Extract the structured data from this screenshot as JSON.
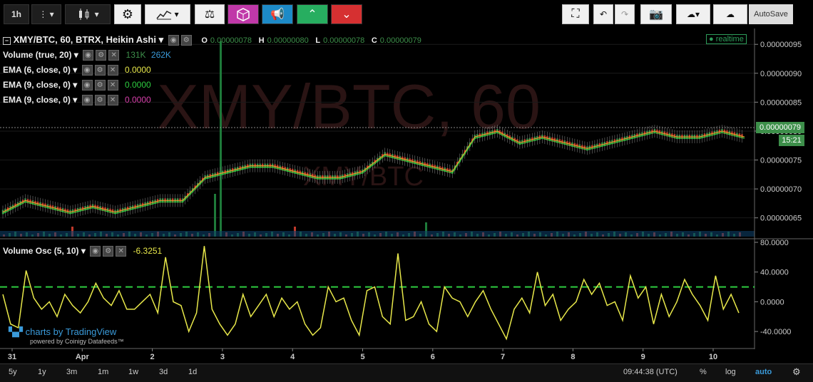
{
  "toolbar": {
    "interval": "1h",
    "autosave": "AutoSave",
    "colors": {
      "pink": "#c038a8",
      "blue": "#1d8ac7",
      "green": "#27ae60",
      "red": "#d63031"
    }
  },
  "legend": {
    "symbol": "XMY/BTC, 60, BTRX, Heikin Ashi",
    "o_label": "O",
    "o_val": "0.00000078",
    "h_label": "H",
    "h_val": "0.00000080",
    "l_label": "L",
    "l_val": "0.00000078",
    "c_label": "C",
    "c_val": "0.00000079",
    "volume": "Volume (true, 20)",
    "vol1": "131K",
    "vol2": "262K",
    "ema1": "EMA (6, close, 0)",
    "ema1_val": "0.0000",
    "ema2": "EMA (9, close, 0)",
    "ema2_val": "0.0000",
    "ema3": "EMA (9, close, 0)",
    "ema3_val": "0.0000",
    "osc": "Volume Osc (5, 10)",
    "osc_val": "-6.3251",
    "realtime": "realtime"
  },
  "watermark": {
    "big": "XMY/BTC, 60",
    "small": "XMY/BTC"
  },
  "price_axis": {
    "ticks": [
      "0.00000095",
      "0.00000090",
      "0.00000085",
      "0.00000080",
      "0.00000075",
      "0.00000070",
      "0.00000065"
    ],
    "last_price": "0.00000079",
    "countdown": "15:21"
  },
  "osc_axis": {
    "ticks": [
      "80.0000",
      "40.0000",
      "0.0000",
      "-40.0000"
    ]
  },
  "time_axis": [
    "31",
    "Apr",
    "2",
    "3",
    "4",
    "5",
    "6",
    "7",
    "8",
    "9",
    "10"
  ],
  "branding": {
    "line1": "charts by TradingView",
    "line2": "powered by Coinigy Datafeeds™"
  },
  "bottom_bar": {
    "ranges": [
      "5y",
      "1y",
      "3m",
      "1m",
      "1w",
      "3d",
      "1d"
    ],
    "clock": "09:44:38 (UTC)",
    "percent": "%",
    "log": "log",
    "auto": "auto"
  },
  "chart_data": [
    {
      "type": "line",
      "title": "XMY/BTC, 60, BTRX, Heikin Ashi",
      "x_categories": [
        "31",
        "Apr",
        "2",
        "3",
        "4",
        "5",
        "6",
        "7",
        "8",
        "9",
        "10"
      ],
      "ylim": [
        6.2e-07,
        9.7e-07
      ],
      "series": [
        {
          "name": "price",
          "color": "#8ba36a",
          "values": [
            6.6e-07,
            6.8e-07,
            6.7e-07,
            6.6e-07,
            6.7e-07,
            6.6e-07,
            6.7e-07,
            6.8e-07,
            6.8e-07,
            7.2e-07,
            7.3e-07,
            7.4e-07,
            7.4e-07,
            7.3e-07,
            7.2e-07,
            7.2e-07,
            7.3e-07,
            7.6e-07,
            7.5e-07,
            7.4e-07,
            7.3e-07,
            7.9e-07,
            8e-07,
            7.8e-07,
            7.9e-07,
            7.8e-07,
            7.7e-07,
            7.8e-07,
            7.9e-07,
            8e-07,
            7.9e-07,
            7.9e-07,
            8e-07,
            7.9e-07
          ]
        }
      ],
      "volume_spikes": [
        0.4,
        0.1,
        0.1,
        0.9,
        0.2,
        0.1,
        0.1,
        0.2,
        0.15,
        0.1,
        0.1,
        0.1
      ]
    },
    {
      "type": "line",
      "title": "Volume Osc (5, 10)",
      "ylim": [
        -60,
        80
      ],
      "reference_line": 20,
      "series": [
        {
          "name": "Volume Osc",
          "color": "#e8e84a",
          "values": [
            10,
            -30,
            -35,
            42,
            5,
            -10,
            0,
            -20,
            10,
            -5,
            -15,
            0,
            25,
            5,
            -5,
            15,
            -10,
            -10,
            0,
            10,
            -15,
            60,
            0,
            -5,
            -40,
            -15,
            75,
            -10,
            -30,
            -45,
            -30,
            10,
            -20,
            -5,
            10,
            -20,
            5,
            -10,
            0,
            -30,
            -45,
            -35,
            20,
            0,
            5,
            -25,
            -45,
            15,
            20,
            -20,
            -30,
            65,
            -25,
            -20,
            0,
            -30,
            -40,
            20,
            5,
            0,
            -20,
            0,
            15,
            -10,
            -30,
            -50,
            -10,
            5,
            -15,
            40,
            -5,
            10,
            -25,
            -10,
            0,
            30,
            10,
            25,
            -5,
            0,
            -25,
            35,
            5,
            20,
            -30,
            10,
            -20,
            0,
            30,
            10,
            -5,
            -25,
            35,
            -10,
            10,
            -15
          ]
        }
      ]
    }
  ]
}
